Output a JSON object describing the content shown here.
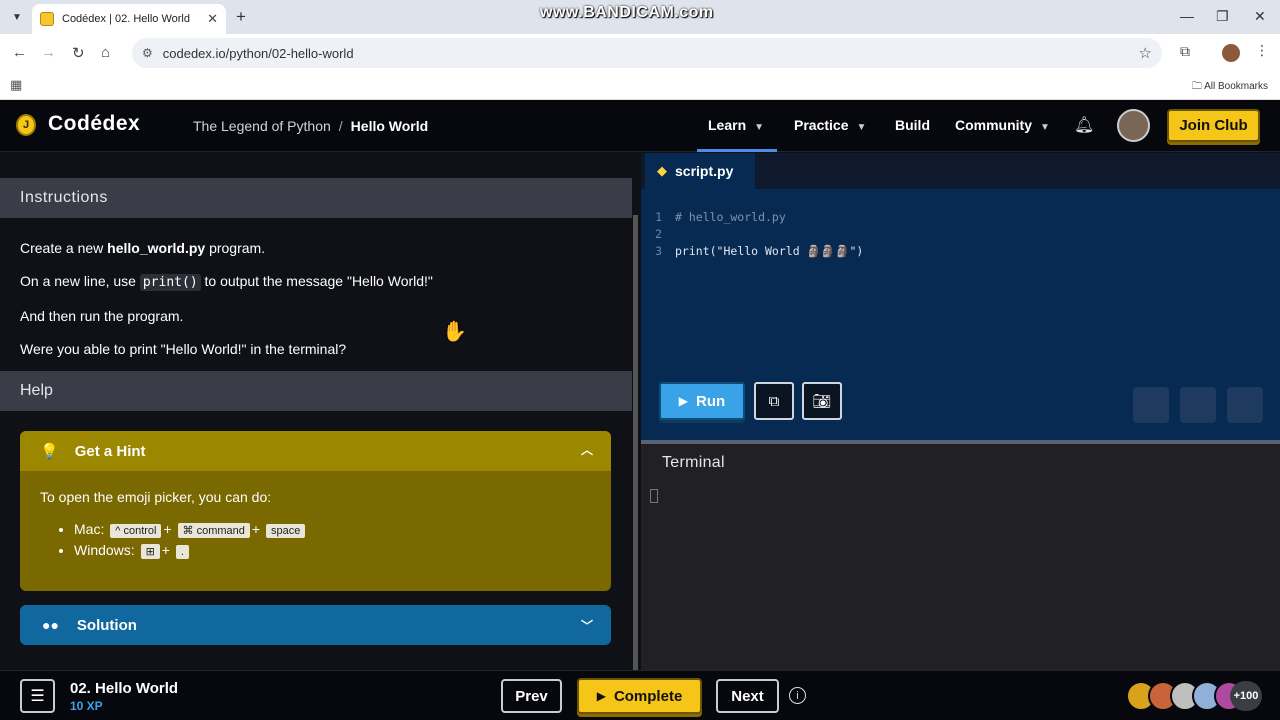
{
  "browser": {
    "tab_title": "Codédex | 02. Hello World",
    "tab_close": "✕",
    "new_tab": "+",
    "watermark": "www.BANDICAM.com",
    "url": "codedex.io/python/02-hello-world",
    "all_bookmarks": "All Bookmarks"
  },
  "header": {
    "logo_text": "Codédex",
    "breadcrumb_course": "The Legend of Python",
    "breadcrumb_sep": "/",
    "breadcrumb_lesson": "Hello World",
    "nav": [
      {
        "label": "Learn"
      },
      {
        "label": "Practice"
      },
      {
        "label": "Build"
      },
      {
        "label": "Community"
      }
    ],
    "join_club": "Join Club"
  },
  "instructions": {
    "heading": "Instructions",
    "line1_pre": "Create a new ",
    "line1_bold": "hello_world.py",
    "line1_post": " program.",
    "line2_pre": "On a new line, use ",
    "line2_code": "print()",
    "line2_post": " to output the message \"Hello World!\"",
    "line3": "And then run the program.",
    "line4": "Were you able to print \"Hello World!\" in the terminal?"
  },
  "help": {
    "heading": "Help",
    "hint_title": "Get a Hint",
    "hint_intro": "To open the emoji picker, you can do:",
    "mac_label": "Mac:",
    "mac_keys": [
      "^ control",
      "⌘ command",
      "space"
    ],
    "windows_label": "Windows:",
    "windows_keys": [
      "⊞",
      "."
    ],
    "plus": "+",
    "solution_title": "Solution"
  },
  "editor": {
    "file_tab": "script.py",
    "lines": [
      {
        "num": "1",
        "text": "# hello_world.py"
      },
      {
        "num": "2",
        "text": ""
      },
      {
        "num": "3",
        "fn": "print",
        "args": "(\"Hello World 🗿🗿🗿\")"
      }
    ],
    "run_label": "Run"
  },
  "terminal": {
    "heading": "Terminal"
  },
  "footer": {
    "lesson_title": "02. Hello World",
    "xp": "10 XP",
    "prev": "Prev",
    "complete": "Complete",
    "next": "Next",
    "more_count": "+100"
  },
  "colors": {
    "accent_yellow": "#f5c518",
    "run_blue": "#3aa3e8",
    "hint_olive": "#9b8700",
    "solution_blue": "#10689e",
    "editor_bg": "#072a52"
  }
}
